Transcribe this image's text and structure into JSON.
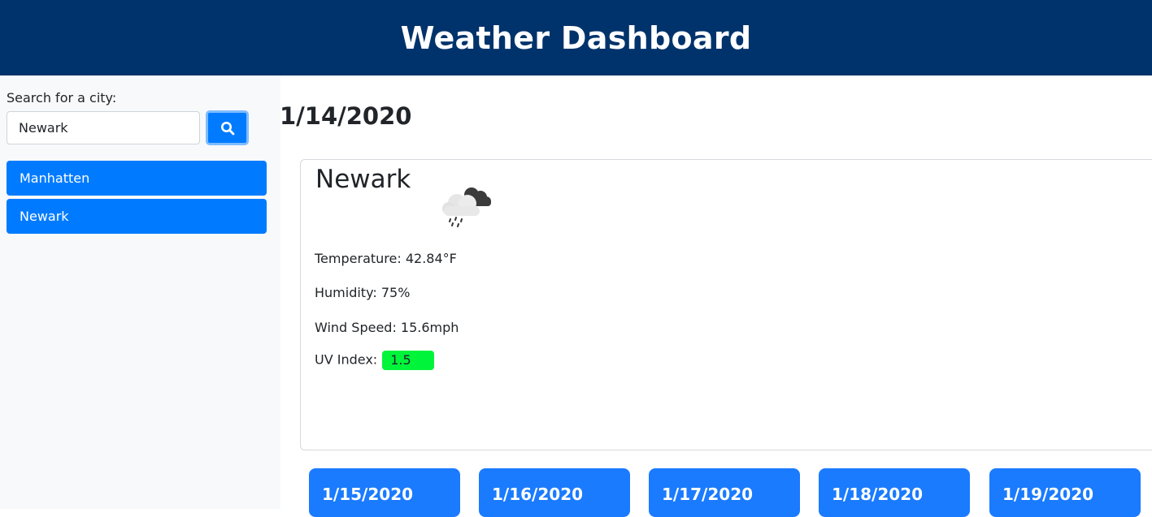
{
  "header": {
    "title": "Weather Dashboard"
  },
  "sidebar": {
    "search_label": "Search for a city:",
    "search_value": "Newark",
    "search_button_icon": "search-icon",
    "cities": [
      {
        "label": "Manhatten"
      },
      {
        "label": "Newark"
      }
    ]
  },
  "current": {
    "date": "1/14/2020",
    "city": "Newark",
    "icon": "rain-cloud-icon",
    "temperature": "Temperature: 42.84°F",
    "humidity": "Humidity: 75%",
    "wind": "Wind Speed: 15.6mph",
    "uv_label": "UV Index:",
    "uv_value": "1.5",
    "uv_color": "#00f53a"
  },
  "forecast": [
    {
      "date": "1/15/2020"
    },
    {
      "date": "1/16/2020"
    },
    {
      "date": "1/17/2020"
    },
    {
      "date": "1/18/2020"
    },
    {
      "date": "1/19/2020"
    }
  ],
  "colors": {
    "header_bg": "#00336b",
    "accent": "#007bff",
    "forecast_bg": "#1a7bff"
  }
}
